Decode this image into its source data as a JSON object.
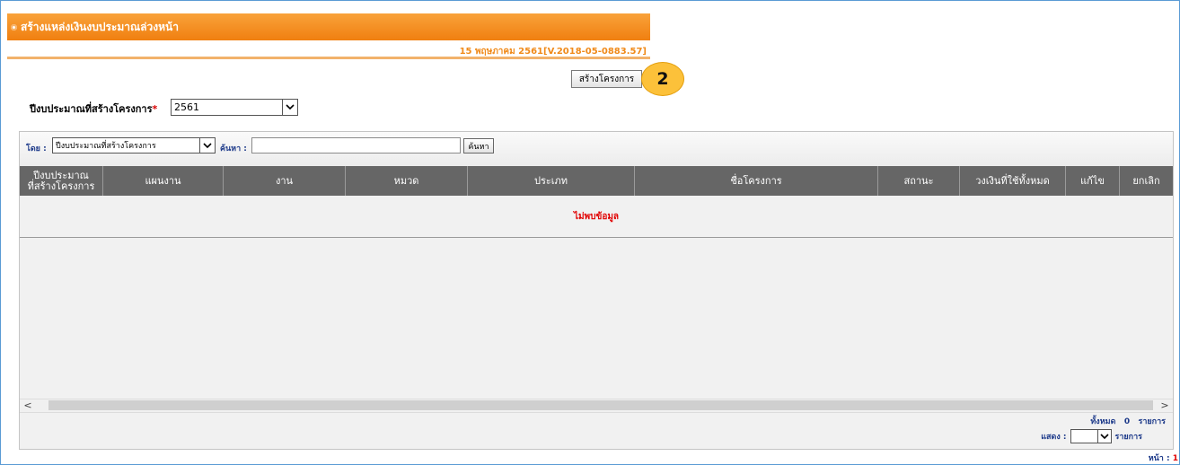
{
  "header": {
    "title": "สร้างแหล่งเงินงบประมาณล่วงหน้า",
    "version": "15 พฤษภาคม 2561[V.2018-05-0883.57]"
  },
  "toolbar": {
    "create_label": "สร้างโครงการ",
    "step_badge": "2"
  },
  "form": {
    "year_label": "ปีงบประมาณที่สร้างโครงการ",
    "required_mark": "*",
    "year_value": "2561"
  },
  "filter": {
    "by_label": "โดย :",
    "by_value": "ปีงบประมาณที่สร้างโครงการ",
    "search_label": "ค้นหา :",
    "search_value": "",
    "search_button": "ค้นหา"
  },
  "table": {
    "columns": [
      "ปีงบประมาณ\nที่สร้างโครงการ",
      "แผนงาน",
      "งาน",
      "หมวด",
      "ประเภท",
      "ชื่อโครงการ",
      "สถานะ",
      "วงเงินที่ใช้ทั้งหมด",
      "แก้ไข",
      "ยกเลิก"
    ],
    "empty_text": "ไม่พบข้อมูล"
  },
  "scrollbar": {
    "left_arrow": "<",
    "right_arrow": ">"
  },
  "footer": {
    "total_label": "ทั้งหมด",
    "total_count": "0",
    "items_label": "รายการ",
    "show_label": "แสดง :",
    "show_value": "",
    "show_items_label": "รายการ",
    "page_label": "หน้า :",
    "page_value": "1"
  }
}
